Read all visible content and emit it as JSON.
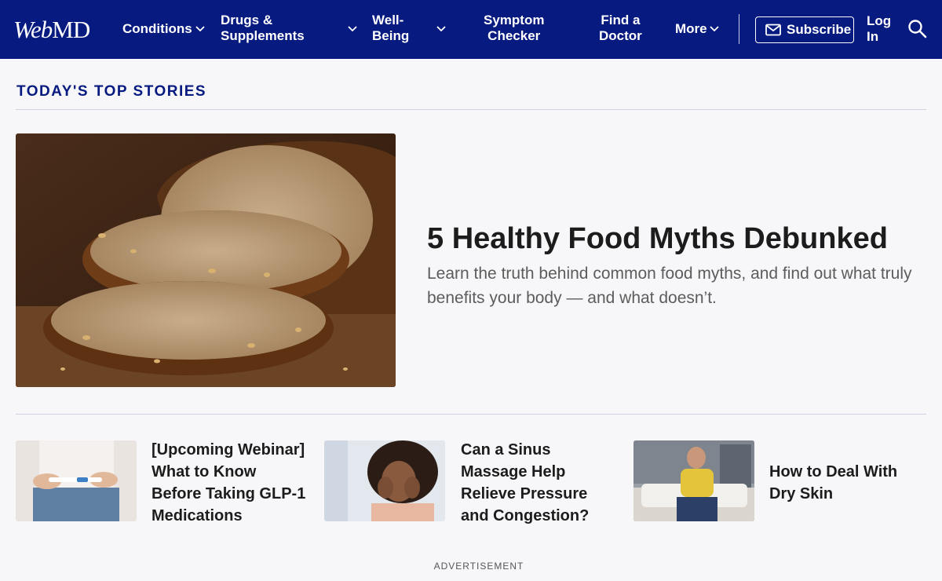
{
  "header": {
    "logo_prefix": "Web",
    "logo_suffix": "MD",
    "nav": {
      "conditions": "Conditions",
      "drugs_line1": "Drugs &",
      "drugs_line2": "Supplements",
      "wellbeing_line1": "Well-",
      "wellbeing_line2": "Being",
      "symptom_line1": "Symptom",
      "symptom_line2": "Checker",
      "doctor_line1": "Find a",
      "doctor_line2": "Doctor",
      "more": "More"
    },
    "subscribe_label": "Subscribe",
    "login_line1": "Log",
    "login_line2": "In",
    "colors": {
      "bar": "#071a80",
      "text": "#ffffff"
    }
  },
  "section": {
    "title": "TODAY'S TOP STORIES"
  },
  "hero": {
    "title": "5 Healthy Food Myths Debunked",
    "description": "Learn the truth behind common food myths, and find out what truly benefits your body — and what doesn’t."
  },
  "cards": [
    {
      "title": "[Upcoming Webinar] What to Know Before Taking GLP-1 Medications"
    },
    {
      "title": "Can a Sinus Massage Help Relieve Pressure and Congestion?"
    },
    {
      "title": "How to Deal With Dry Skin"
    }
  ],
  "advertisement_label": "ADVERTISEMENT",
  "icons": {
    "chevron": "chevron-down-icon",
    "mail": "mail-icon",
    "search": "search-icon"
  }
}
